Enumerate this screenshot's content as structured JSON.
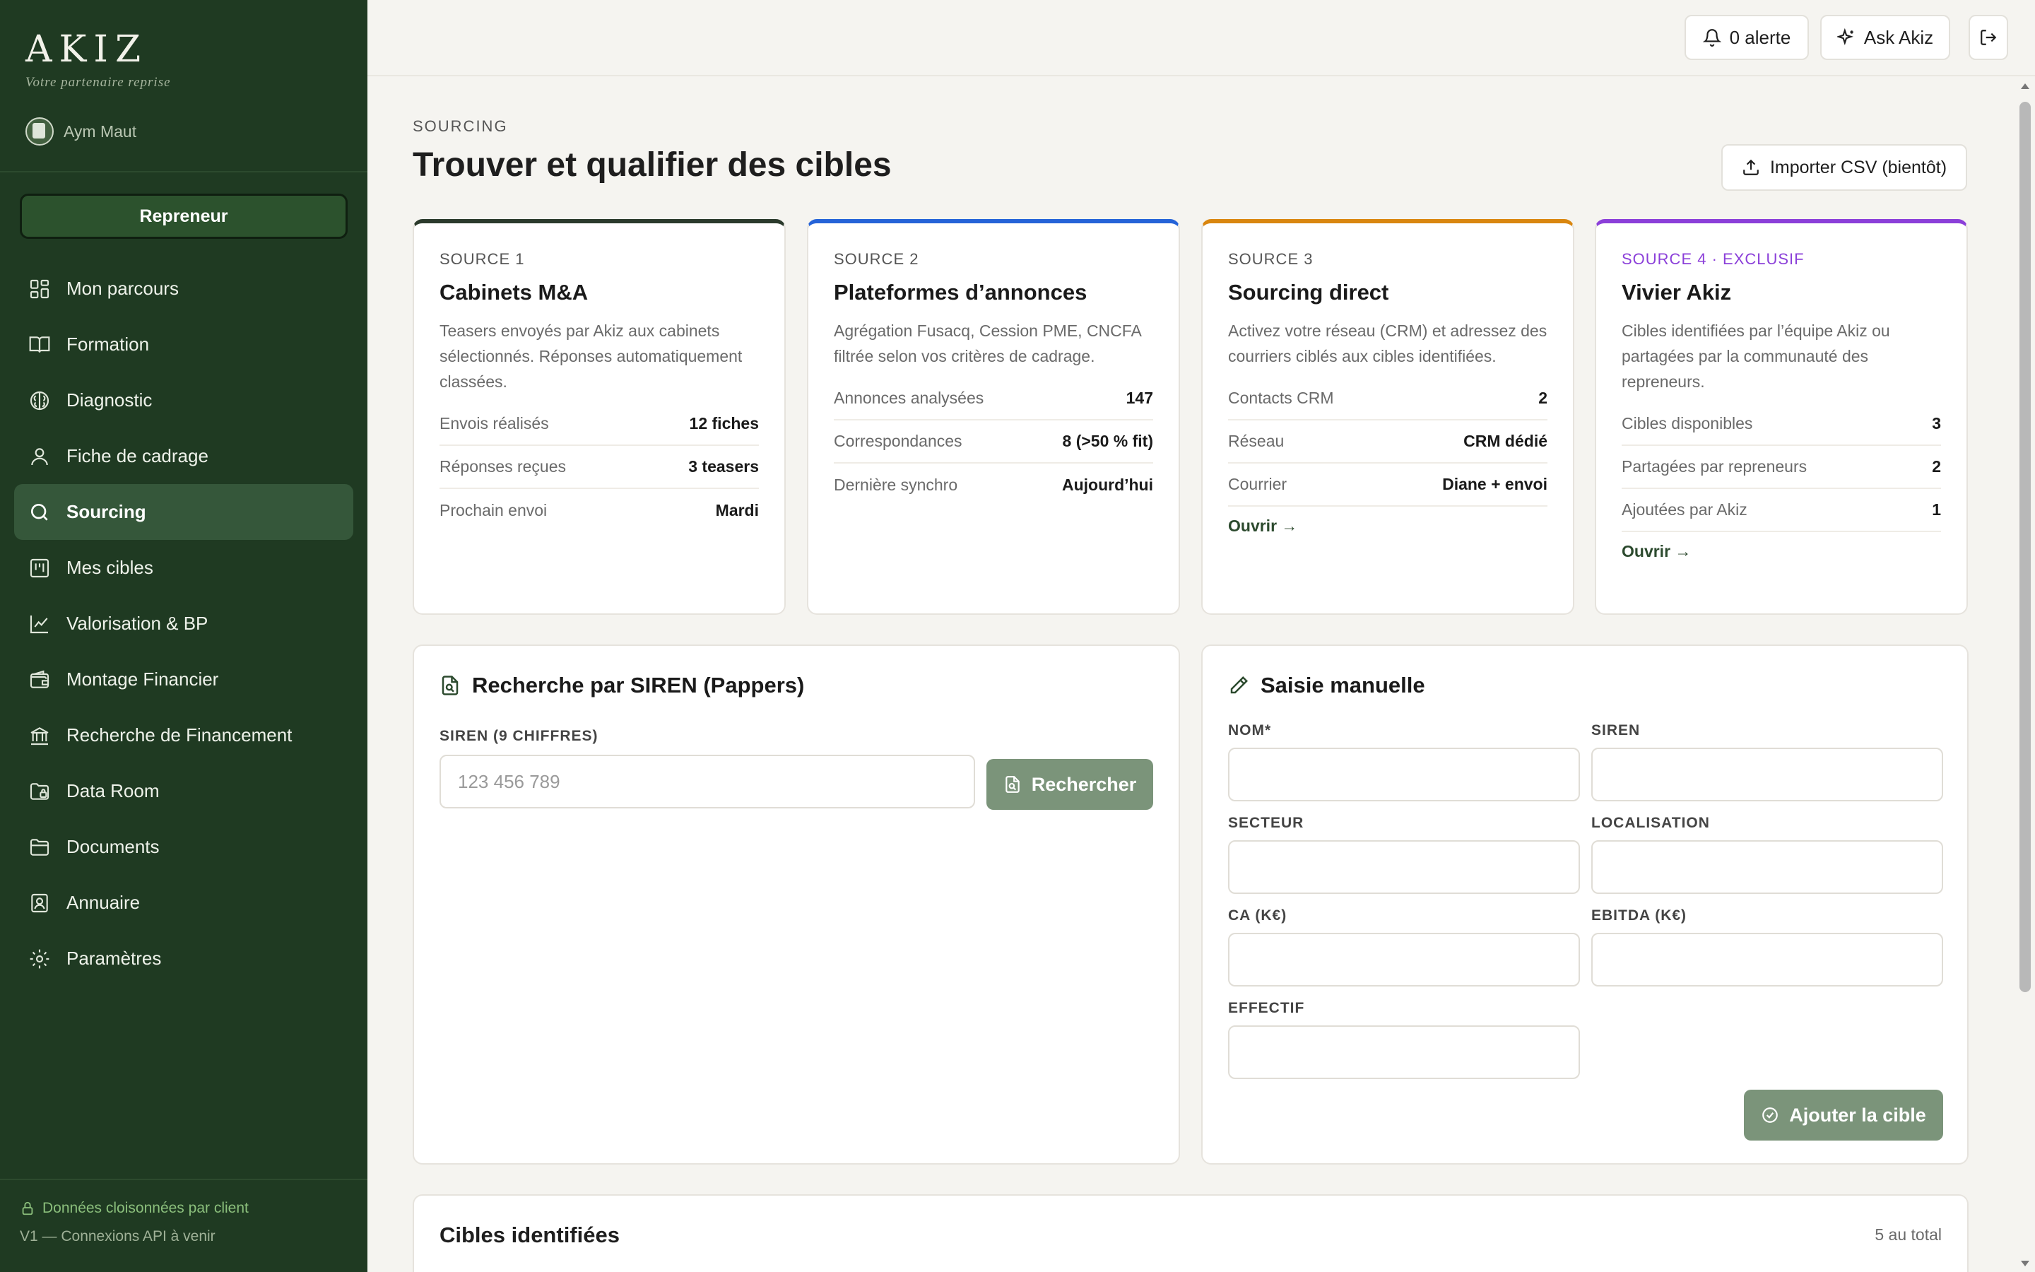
{
  "brand": {
    "name": "AKIZ",
    "tagline": "Votre partenaire reprise"
  },
  "user": {
    "name": "Aym Maut"
  },
  "role_button": "Repreneur",
  "nav": [
    {
      "label": "Mon parcours",
      "icon": "dashboard-icon",
      "active": false
    },
    {
      "label": "Formation",
      "icon": "book-icon",
      "active": false
    },
    {
      "label": "Diagnostic",
      "icon": "brain-icon",
      "active": false
    },
    {
      "label": "Fiche de cadrage",
      "icon": "user-icon",
      "active": false
    },
    {
      "label": "Sourcing",
      "icon": "search-icon",
      "active": true
    },
    {
      "label": "Mes cibles",
      "icon": "kanban-icon",
      "active": false
    },
    {
      "label": "Valorisation & BP",
      "icon": "chart-icon",
      "active": false
    },
    {
      "label": "Montage Financier",
      "icon": "wallet-icon",
      "active": false
    },
    {
      "label": "Recherche de Financement",
      "icon": "bank-icon",
      "active": false
    },
    {
      "label": "Data Room",
      "icon": "folder-lock-icon",
      "active": false
    },
    {
      "label": "Documents",
      "icon": "folder-icon",
      "active": false
    },
    {
      "label": "Annuaire",
      "icon": "contact-icon",
      "active": false
    },
    {
      "label": "Paramètres",
      "icon": "gear-icon",
      "active": false
    }
  ],
  "sidebar_footer": {
    "privacy": "Données cloisonnées par client",
    "version": "V1 — Connexions API à venir"
  },
  "topbar": {
    "alerts": "0 alerte",
    "ask": "Ask Akiz"
  },
  "page": {
    "breadcrumb": "SOURCING",
    "title": "Trouver et qualifier des cibles",
    "import_button": "Importer CSV (bientôt)"
  },
  "sources": [
    {
      "kicker": "SOURCE 1",
      "title": "Cabinets M&A",
      "desc": "Teasers envoyés par Akiz aux cabinets sélectionnés. Réponses automatiquement classées.",
      "accent": "#2b3a2c",
      "rows": [
        {
          "k": "Envois réalisés",
          "v": "12 fiches"
        },
        {
          "k": "Réponses reçues",
          "v": "3 teasers"
        },
        {
          "k": "Prochain envoi",
          "v": "Mardi"
        }
      ],
      "link": ""
    },
    {
      "kicker": "SOURCE 2",
      "title": "Plateformes d’annonces",
      "desc": "Agrégation Fusacq, Cession PME, CNCFA filtrée selon vos critères de cadrage.",
      "accent": "#2563d8",
      "rows": [
        {
          "k": "Annonces analysées",
          "v": "147"
        },
        {
          "k": "Correspondances",
          "v": "8 (>50 % fit)"
        },
        {
          "k": "Dernière synchro",
          "v": "Aujourd’hui"
        }
      ],
      "link": ""
    },
    {
      "kicker": "SOURCE 3",
      "title": "Sourcing direct",
      "desc": "Activez votre réseau (CRM) et adressez des courriers ciblés aux cibles identifiées.",
      "accent": "#d9860f",
      "rows": [
        {
          "k": "Contacts CRM",
          "v": "2"
        },
        {
          "k": "Réseau",
          "v": "CRM dédié"
        },
        {
          "k": "Courrier",
          "v": "Diane + envoi"
        }
      ],
      "link": "Ouvrir →"
    },
    {
      "kicker": "SOURCE 4 · EXCLUSIF",
      "title": "Vivier Akiz",
      "desc": "Cibles identifiées par l’équipe Akiz ou partagées par la communauté des repreneurs.",
      "accent": "#8b3fd9",
      "rows": [
        {
          "k": "Cibles disponibles",
          "v": "3"
        },
        {
          "k": "Partagées par repreneurs",
          "v": "2"
        },
        {
          "k": "Ajoutées par Akiz",
          "v": "1"
        }
      ],
      "link": "Ouvrir →"
    }
  ],
  "siren": {
    "title": "Recherche par SIREN (Pappers)",
    "label": "SIREN (9 CHIFFRES)",
    "placeholder": "123 456 789",
    "button": "Rechercher"
  },
  "manual": {
    "title": "Saisie manuelle",
    "fields": {
      "nom": "NOM*",
      "siren": "SIREN",
      "secteur": "SECTEUR",
      "localisation": "LOCALISATION",
      "ca": "CA (K€)",
      "ebitda": "EBITDA (K€)",
      "effectif": "EFFECTIF"
    },
    "button": "Ajouter la cible"
  },
  "targets": {
    "title": "Cibles identifiées",
    "count": "5 au total"
  }
}
